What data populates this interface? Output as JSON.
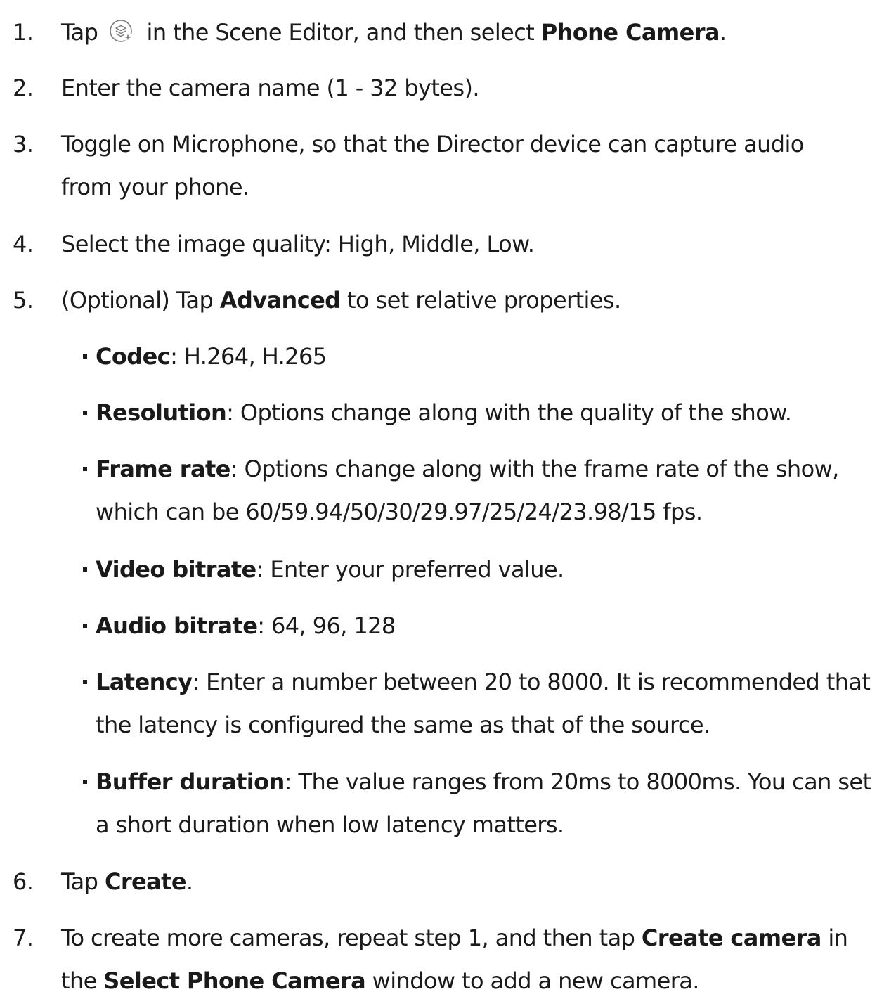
{
  "steps": [
    {
      "num": "1.",
      "t1": "Tap ",
      "icon": "add-scene-layers-icon",
      "t2": " in the Scene Editor, and then select ",
      "b1": "Phone Camera",
      "t3": "."
    },
    {
      "num": "2.",
      "text": "Enter the camera name (1 - 32 bytes)."
    },
    {
      "num": "3.",
      "line1": "Toggle on Microphone, so that the Director device can capture audio",
      "line2": "from your phone."
    },
    {
      "num": "4.",
      "text": "Select the image quality: High, Middle, Low."
    },
    {
      "num": "5.",
      "t1": "(Optional) Tap ",
      "b1": "Advanced",
      "t2": " to set relative properties."
    },
    {
      "num": "6.",
      "t1": "Tap ",
      "b1": "Create",
      "t2": "."
    },
    {
      "num": "7.",
      "t1": "To create more cameras, repeat step 1, and then tap ",
      "b1": "Create camera",
      "t2": " in",
      "line2_t1": "the ",
      "line2_b1": "Select Phone Camera",
      "line2_t2": " window to add a new camera."
    }
  ],
  "advanced": [
    {
      "label": "Codec",
      "desc": ": H.264, H.265"
    },
    {
      "label": "Resolution",
      "desc": ": Options change along with the quality of the show."
    },
    {
      "label": "Frame rate",
      "desc": ": Options change along with the frame rate of the show,",
      "desc2": "which can be 60/59.94/50/30/29.97/25/24/23.98/15 fps."
    },
    {
      "label": "Video bitrate",
      "desc": ": Enter your preferred value."
    },
    {
      "label": "Audio bitrate",
      "desc": ": 64, 96, 128"
    },
    {
      "label": "Latency",
      "desc": ": Enter a number between 20 to 8000. It is recommended that",
      "desc2": "the latency is configured the same as that of the source."
    },
    {
      "label": "Buffer duration",
      "desc": ": The value ranges from 20ms to 8000ms. You can set",
      "desc2": "a short duration when low latency matters."
    }
  ]
}
